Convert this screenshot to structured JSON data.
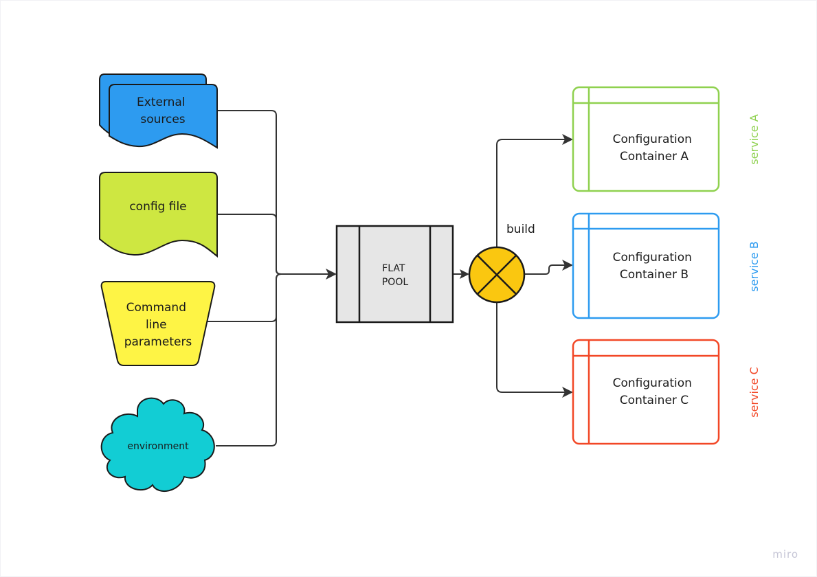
{
  "diagram": {
    "inputs": [
      {
        "id": "external",
        "label_lines": [
          "External",
          "sources"
        ],
        "shape": "multi-document",
        "color": "#2d9bf0"
      },
      {
        "id": "config",
        "label_lines": [
          "config file"
        ],
        "shape": "document",
        "color": "#cee741"
      },
      {
        "id": "cli",
        "label_lines": [
          "Command",
          "line",
          "parameters"
        ],
        "shape": "manual-operation",
        "color": "#fef445"
      },
      {
        "id": "env",
        "label_lines": [
          "environment"
        ],
        "shape": "cloud",
        "color": "#12cdd4"
      }
    ],
    "pool": {
      "label_lines": [
        "FLAT",
        "POOL"
      ],
      "shape": "predefined-process",
      "color": "#e6e6e6"
    },
    "junction": {
      "label": "build",
      "shape": "summing-junction",
      "color": "#fac710"
    },
    "containers": [
      {
        "id": "a",
        "label_lines": [
          "Configuration",
          "Container A"
        ],
        "service_label": "service A",
        "color": "#8fd14f"
      },
      {
        "id": "b",
        "label_lines": [
          "Configuration",
          "Container B"
        ],
        "service_label": "service B",
        "color": "#2d9bf0"
      },
      {
        "id": "c",
        "label_lines": [
          "Configuration",
          "Container C"
        ],
        "service_label": "service C",
        "color": "#f24726"
      }
    ],
    "edge_color": "#333333",
    "stroke_color": "#1a1a1a"
  },
  "watermark": "miro"
}
